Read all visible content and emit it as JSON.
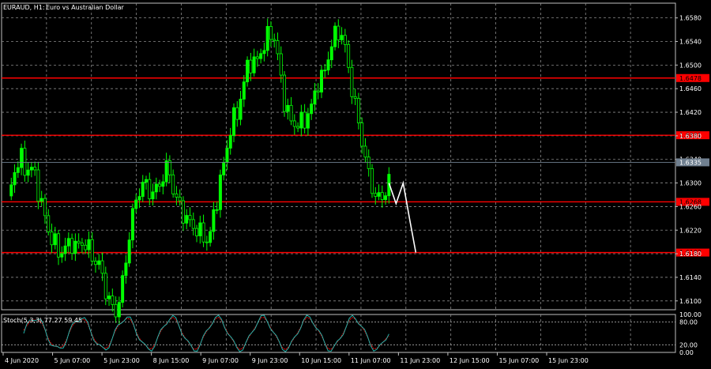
{
  "header": {
    "symbol": "EURAUD, H1:",
    "description": "Euro vs Australian Dollar"
  },
  "price_axis": {
    "ticks": [
      "1.6580",
      "1.6540",
      "1.6500",
      "1.6460",
      "1.6420",
      "1.6380",
      "1.6340",
      "1.6300",
      "1.6260",
      "1.6220",
      "1.6180",
      "1.6140",
      "1.6100"
    ],
    "tick_values": [
      1.658,
      1.654,
      1.65,
      1.646,
      1.642,
      1.638,
      1.634,
      1.63,
      1.626,
      1.622,
      1.618,
      1.614,
      1.61
    ],
    "current_price": "1.6335"
  },
  "levels": [
    {
      "label": "1.6478",
      "value": 1.6478
    },
    {
      "label": "1.6381",
      "value": 1.6381
    },
    {
      "label": "1.6268",
      "value": 1.6268
    },
    {
      "label": "1.6182",
      "value": 1.6182
    }
  ],
  "oscillator": {
    "label": "Stoch(5,3,3) 77.27 59.45",
    "ticks": [
      "100.00",
      "80.00",
      "20.00",
      "0.00"
    ]
  },
  "time_axis": {
    "labels": [
      "4 Jun 2020",
      "5 Jun 07:00",
      "5 Jun 23:00",
      "8 Jun 15:00",
      "9 Jun 07:00",
      "9 Jun 23:00",
      "10 Jun 15:00",
      "11 Jun 07:00",
      "11 Jun 23:00",
      "12 Jun 15:00",
      "15 Jun 07:00",
      "15 Jun 23:00"
    ]
  },
  "colors": {
    "background": "#000000",
    "grid": "#8a8a8a",
    "candle": "#00ff00",
    "level": "#ff0000",
    "projection": "#ffffff",
    "stoch_main": "#20b2aa",
    "stoch_signal": "#ff0000"
  },
  "chart_data": {
    "type": "line",
    "title": "EURAUD, H1: Euro vs Australian Dollar",
    "ylim": [
      1.6085,
      1.6605
    ],
    "series": [
      {
        "name": "EURAUD",
        "x": [
          0,
          1,
          2,
          3,
          4,
          5,
          6,
          7,
          8,
          9,
          10,
          11,
          12,
          13,
          14,
          15,
          16,
          17,
          18,
          19,
          20,
          21,
          22,
          23,
          24,
          25,
          26,
          27,
          28,
          29,
          30,
          31,
          32,
          33,
          34,
          35,
          36,
          37,
          38,
          39,
          40,
          41,
          42,
          43,
          44,
          45,
          46,
          47,
          48,
          49,
          50,
          51,
          52,
          53,
          54,
          55,
          56,
          57,
          58,
          59,
          60,
          61,
          62,
          63,
          64,
          65,
          66,
          67,
          68
        ],
        "values": [
          1.627,
          1.631,
          1.635,
          1.632,
          1.633,
          1.63,
          1.626,
          1.622,
          1.62,
          1.618,
          1.619,
          1.62,
          1.619,
          1.62,
          1.619,
          1.617,
          1.616,
          1.612,
          1.609,
          1.608,
          1.613,
          1.62,
          1.626,
          1.629,
          1.63,
          1.628,
          1.629,
          1.631,
          1.633,
          1.628,
          1.626,
          1.624,
          1.623,
          1.622,
          1.621,
          1.62,
          1.625,
          1.63,
          1.635,
          1.64,
          1.642,
          1.646,
          1.651,
          1.65,
          1.652,
          1.654,
          1.656,
          1.652,
          1.645,
          1.641,
          1.64,
          1.64,
          1.641,
          1.643,
          1.647,
          1.648,
          1.652,
          1.655,
          1.656,
          1.652,
          1.646,
          1.641,
          1.636,
          1.631,
          1.628,
          1.627,
          1.629,
          1.632,
          1.6335
        ]
      },
      {
        "name": "projection",
        "x": [
          68,
          69,
          70,
          71,
          72
        ],
        "values": [
          1.63,
          1.6265,
          1.63,
          1.624,
          1.6182
        ]
      }
    ]
  }
}
